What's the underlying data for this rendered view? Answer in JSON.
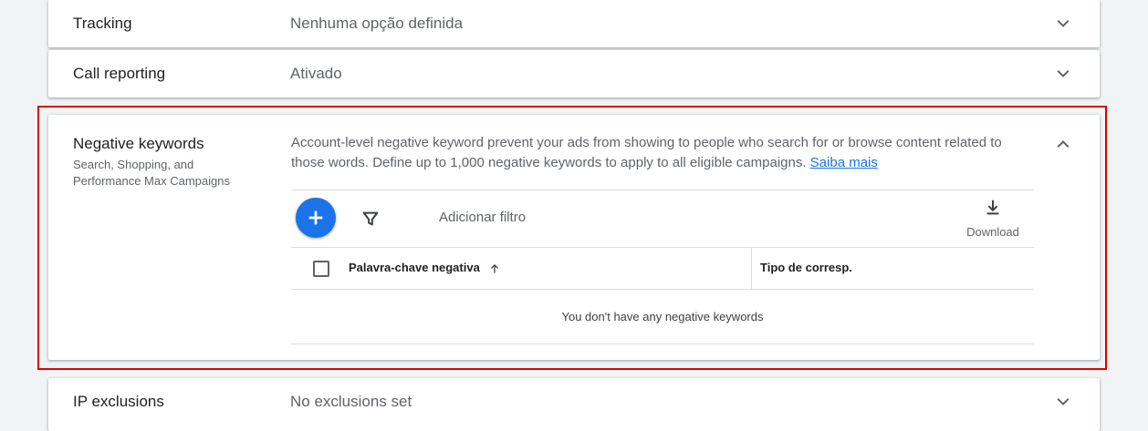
{
  "sections": {
    "tracking": {
      "title": "Tracking",
      "value": "Nenhuma opção definida"
    },
    "call_reporting": {
      "title": "Call reporting",
      "value": "Ativado"
    },
    "negative_keywords": {
      "title": "Negative keywords",
      "subtitle": "Search, Shopping, and Performance Max Campaigns",
      "description": "Account-level negative keyword prevent your ads from showing to people who search for or browse content related to those words. Define up to 1,000 negative keywords to apply to all eligible campaigns.",
      "learn_more": "Saiba mais",
      "toolbar": {
        "add_filter": "Adicionar filtro",
        "download": "Download"
      },
      "table": {
        "columns": [
          "Palavra-chave negativa",
          "Tipo de corresp."
        ],
        "empty_message": "You don't have any negative keywords"
      }
    },
    "ip_exclusions": {
      "title": "IP exclusions",
      "value": "No exclusions set"
    }
  },
  "colors": {
    "accent": "#1a73e8",
    "highlight": "#e00000"
  }
}
